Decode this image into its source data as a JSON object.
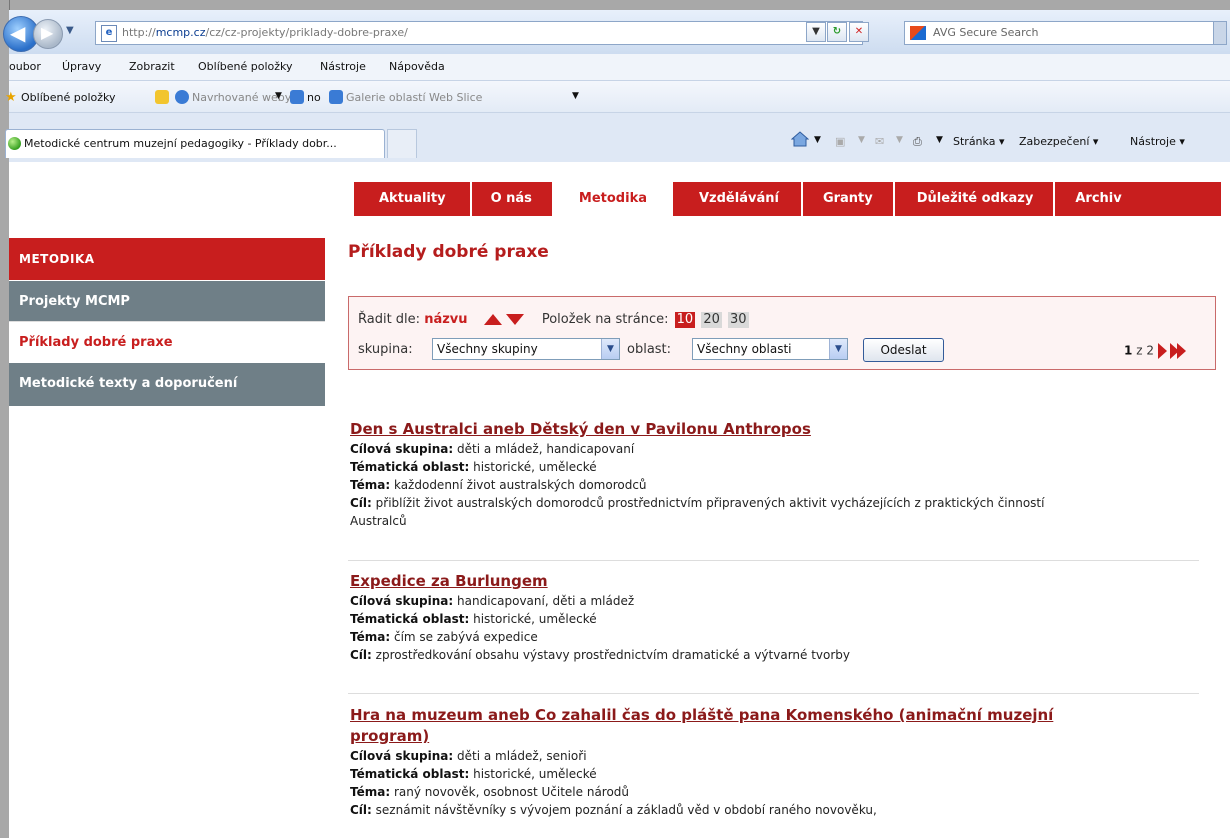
{
  "browser": {
    "url_prefix": "http://",
    "url_host": "mcmp.cz",
    "url_path": "/cz/cz-projekty/priklady-dobre-praxe/",
    "search_placeholder": "AVG Secure Search",
    "menu": [
      "oubor",
      "Úpravy",
      "Zobrazit",
      "Oblíbené položky",
      "Nástroje",
      "Nápověda"
    ],
    "favorites_label": "Oblíbené položky",
    "suggested_sites": "Navrhované weby",
    "fav_no": "no",
    "web_slice_gallery": "Galerie oblastí Web Slice",
    "tab_title": "Metodické centrum muzejní pedagogiky - Příklady dobr...",
    "commands": {
      "page": "Stránka",
      "security": "Zabezpečení",
      "tools": "Nástroje"
    }
  },
  "topnav": [
    "Aktuality",
    "O nás",
    "Metodika",
    "Vzdělávání",
    "Granty",
    "Důležité odkazy",
    "Archiv"
  ],
  "sidebar": {
    "heading": "METODIKA",
    "items": [
      {
        "label": "Projekty MCMP"
      },
      {
        "label": "Příklady dobré praxe"
      },
      {
        "label": "Metodické texty a doporučení"
      }
    ]
  },
  "page_title": "Příklady dobré praxe",
  "filter": {
    "sort_label": "Řadit dle:",
    "sort_value": "názvu",
    "per_page_label": "Položek na stránce:",
    "per_page_options": [
      "10",
      "20",
      "30"
    ],
    "group_label": "skupina:",
    "group_value": "Všechny skupiny",
    "area_label": "oblast:",
    "area_value": "Všechny oblasti",
    "submit_label": "Odeslat",
    "page_current": "1",
    "page_of": "z",
    "page_total": "2"
  },
  "labels": {
    "target": "Cílová skupina:",
    "area": "Tématická oblast:",
    "theme": "Téma:",
    "goal": "Cíl:"
  },
  "articles": [
    {
      "title": "Den s Australci aneb Dětský den v Pavilonu Anthropos",
      "target": "děti a mládež, handicapovaní",
      "area": "historické, umělecké",
      "theme": "každodenní život australských domorodců",
      "goal": "přiblížit život australských domorodců prostřednictvím připravených aktivit vycházejících z praktických činností Australců"
    },
    {
      "title": "Expedice za Burlungem",
      "target": "handicapovaní, děti a mládež",
      "area": "historické, umělecké",
      "theme": "čím se zabývá expedice",
      "goal": "zprostředkování obsahu výstavy prostřednictvím dramatické a výtvarné tvorby"
    },
    {
      "title": "Hra na muzeum aneb Co zahalil čas do pláště pana Komenského (animační muzejní program)",
      "target": "děti a mládež, senioři",
      "area": "historické, umělecké",
      "theme": "raný novověk, osobnost Učitele národů",
      "goal": "seznámit návštěvníky s vývojem poznání a základů věd v období raného novověku,"
    }
  ],
  "colors": {
    "accent": "#c81e1e",
    "sidebar_grey": "#6f7f87",
    "title_dark_red": "#8b1a1a"
  }
}
